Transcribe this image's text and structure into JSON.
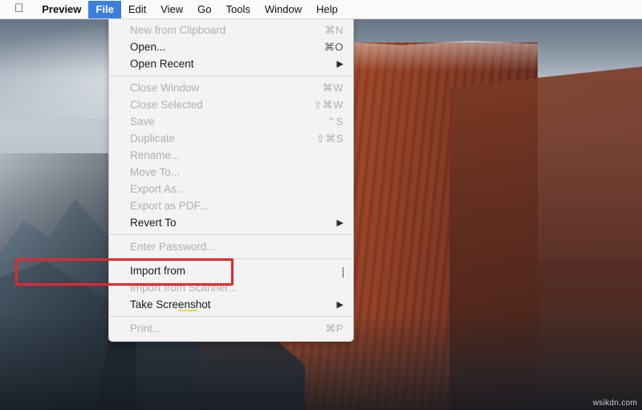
{
  "menubar": {
    "apple_icon": "apple-icon",
    "items": [
      {
        "label": "Preview",
        "bold": true,
        "active": false
      },
      {
        "label": "File",
        "bold": true,
        "active": true
      },
      {
        "label": "Edit",
        "bold": false,
        "active": false
      },
      {
        "label": "View",
        "bold": false,
        "active": false
      },
      {
        "label": "Go",
        "bold": false,
        "active": false
      },
      {
        "label": "Tools",
        "bold": false,
        "active": false
      },
      {
        "label": "Window",
        "bold": false,
        "active": false
      },
      {
        "label": "Help",
        "bold": false,
        "active": false
      }
    ]
  },
  "file_menu": {
    "items": [
      {
        "label": "New from Clipboard",
        "shortcut": "⌘N",
        "enabled": false,
        "submenu": false
      },
      {
        "label": "Open...",
        "shortcut": "⌘O",
        "enabled": true,
        "submenu": false
      },
      {
        "label": "Open Recent",
        "shortcut": "",
        "enabled": true,
        "submenu": true
      },
      {
        "separator": true
      },
      {
        "label": "Close Window",
        "shortcut": "⌘W",
        "enabled": false,
        "submenu": false
      },
      {
        "label": "Close Selected",
        "shortcut": "⇧⌘W",
        "enabled": false,
        "submenu": false
      },
      {
        "label": "Save",
        "shortcut": "⌃S",
        "enabled": false,
        "submenu": false
      },
      {
        "label": "Duplicate",
        "shortcut": "⇧⌘S",
        "enabled": false,
        "submenu": false
      },
      {
        "label": "Rename...",
        "shortcut": "",
        "enabled": false,
        "submenu": false
      },
      {
        "label": "Move To...",
        "shortcut": "",
        "enabled": false,
        "submenu": false
      },
      {
        "label": "Export As...",
        "shortcut": "",
        "enabled": false,
        "submenu": false
      },
      {
        "label": "Export as PDF...",
        "shortcut": "",
        "enabled": false,
        "submenu": false
      },
      {
        "label": "Revert To",
        "shortcut": "",
        "enabled": true,
        "submenu": true
      },
      {
        "separator": true
      },
      {
        "label": "Enter Password...",
        "shortcut": "",
        "enabled": false,
        "submenu": false
      },
      {
        "separator": true
      },
      {
        "label": "Import from",
        "shortcut": "",
        "enabled": true,
        "submenu": false,
        "highlighted": true
      },
      {
        "label": "Import from Scanner...",
        "shortcut": "",
        "enabled": false,
        "submenu": false
      },
      {
        "label": "Take Screenshot",
        "shortcut": "",
        "enabled": true,
        "submenu": true
      },
      {
        "separator": true
      },
      {
        "label": "Print...",
        "shortcut": "⌘P",
        "enabled": false,
        "submenu": false
      }
    ]
  },
  "annotations": {
    "highlight_color": "#e8262a",
    "underline_color": "#f2d642"
  },
  "watermark": {
    "text": "wsikdn.com"
  }
}
